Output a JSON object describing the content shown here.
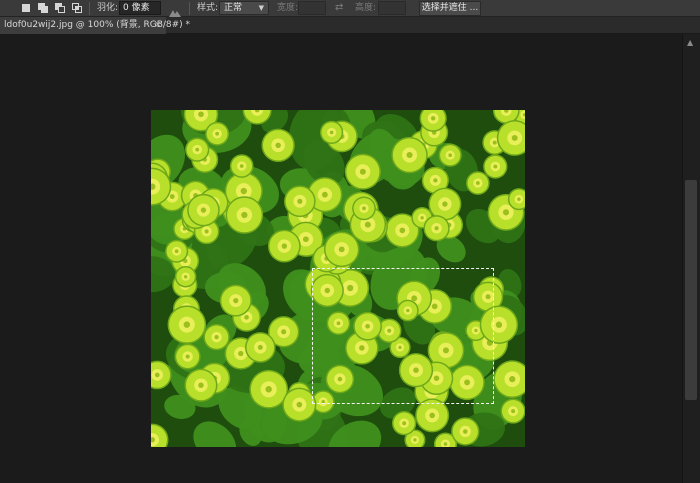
{
  "options_bar": {
    "feather_label": "羽化:",
    "feather_value": "0 像素",
    "style_label": "样式:",
    "style_value": "正常",
    "width_label": "宽度:",
    "height_label": "高度:",
    "select_mask_button": "选择并遮住 ..."
  },
  "tabs": [
    {
      "label": "ldof0u2wij2.jpg @ 100% (背景, RGB/8#) *",
      "close": "×"
    }
  ],
  "icons": [
    "new-selection-icon",
    "add-to-selection-icon",
    "subtract-from-selection-icon",
    "intersect-selection-icon",
    "anti-alias-icon",
    "swap-icon",
    "close-icon",
    "scroll-up-icon"
  ],
  "colors": {
    "leaf": "#3f8f1e",
    "leaf_dark": "#1e4d0e",
    "flower": "#b8e02a",
    "flower_center": "#e8ef58",
    "marquee": "#f2f2f2"
  }
}
